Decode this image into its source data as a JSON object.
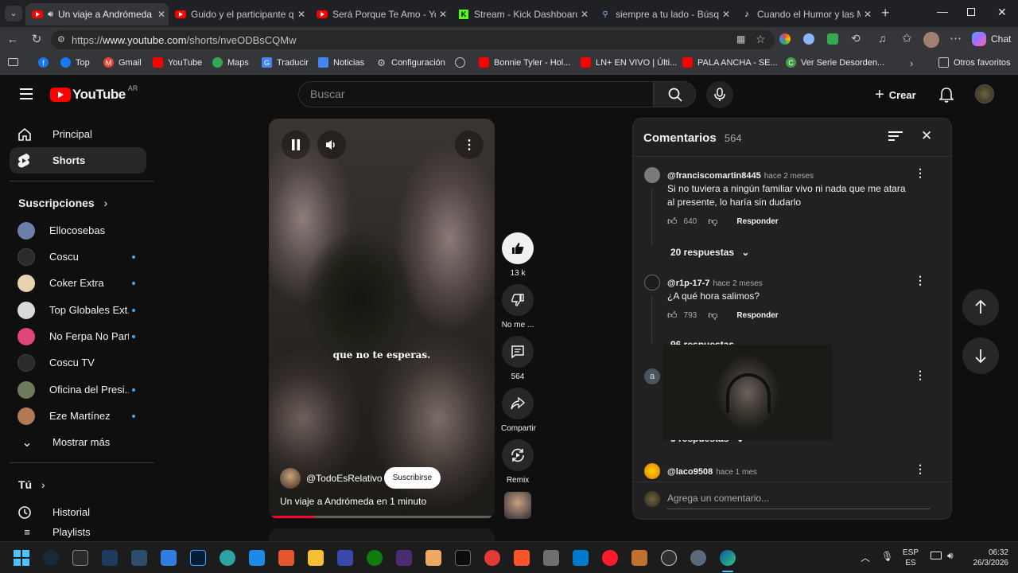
{
  "browser": {
    "tabs": [
      {
        "title": "Un viaje a Andrómeda en",
        "icon": "youtube",
        "active": true
      },
      {
        "title": "Guido y el participante que e",
        "icon": "youtube"
      },
      {
        "title": "Será Porque Te Amo - YouTub",
        "icon": "youtube"
      },
      {
        "title": "Stream - Kick Dashboard",
        "icon": "kick"
      },
      {
        "title": "siempre a tu lado - Búsqueda",
        "icon": "search"
      },
      {
        "title": "Cuando el Humor y las Mate",
        "icon": "tiktok"
      }
    ],
    "url_prefix": "https://",
    "url_host": "www.youtube.com",
    "url_path": "/shorts/nveODBsCQMw",
    "chat_label": "Chat",
    "bookmarks": [
      {
        "label": "Top",
        "color": "#1877f2"
      },
      {
        "label": "Gmail",
        "color": "#ea4335"
      },
      {
        "label": "YouTube",
        "color": "#ff0000"
      },
      {
        "label": "Maps",
        "color": "#34a853"
      },
      {
        "label": "Traducir",
        "color": "#4285f4"
      },
      {
        "label": "Noticias",
        "color": "#4285f4"
      },
      {
        "label": "Configuración",
        "color": "#9aa0a6"
      },
      {
        "label": "",
        "color": "#9aa0a6"
      },
      {
        "label": "Bonnie Tyler - Hol...",
        "color": "#ff0000"
      },
      {
        "label": "LN+ EN VIVO | Últi...",
        "color": "#ff0000"
      },
      {
        "label": "PALA ANCHA - SE...",
        "color": "#ff0000"
      },
      {
        "label": "Ver Serie Desorden...",
        "color": "#43a047"
      }
    ],
    "other_bookmarks": "Otros favoritos"
  },
  "youtube": {
    "logo_text": "YouTube",
    "country": "AR",
    "search_placeholder": "Buscar",
    "create_label": "Crear",
    "sidebar": {
      "main": [
        {
          "label": "Principal",
          "icon": "home-icon"
        },
        {
          "label": "Shorts",
          "icon": "shorts-icon"
        }
      ],
      "subs_header": "Suscripciones",
      "subs": [
        {
          "name": "Ellocosebas",
          "color": "#6b7fa8",
          "dot": false
        },
        {
          "name": "Coscu",
          "color": "#2a2a2a",
          "dot": true
        },
        {
          "name": "Coker Extra",
          "color": "#e8d2b0",
          "dot": true
        },
        {
          "name": "Top Globales Ext...",
          "color": "#d9d9d9",
          "dot": true
        },
        {
          "name": "No Ferpa No Party",
          "color": "#e0457a",
          "dot": true
        },
        {
          "name": "Coscu TV",
          "color": "#2a2a2a",
          "dot": false
        },
        {
          "name": "Oficina del Presi...",
          "color": "#6d7b5a",
          "dot": true
        },
        {
          "name": "Eze Martínez",
          "color": "#b07a55",
          "dot": true
        }
      ],
      "show_more": "Mostrar más",
      "you_header": "Tú",
      "history": "Historial",
      "playlists": "Playlists"
    },
    "short": {
      "caption": "que no te esperas.",
      "channel": "@TodoEsRelativo",
      "subscribe": "Suscribirse",
      "title": "Un viaje a Andrómeda en 1 minuto",
      "progress": 0.2
    },
    "actions": {
      "likes": "13 k",
      "dislike": "No me ...",
      "comments": "564",
      "share": "Compartir",
      "remix": "Remix"
    },
    "comments_panel": {
      "title": "Comentarios",
      "count": "564",
      "items": [
        {
          "author": "@franciscomartin8445",
          "time": "hace 2 meses",
          "text": "Si no tuviera a ningún familiar vivo ni nada que me atara al presente, lo haría sin dudarlo",
          "likes": "640",
          "reply": "Responder",
          "replies": "20 respuestas"
        },
        {
          "author": "@r1p-17-7",
          "time": "hace 2 meses",
          "text": "¿A qué hora salimos?",
          "likes": "793",
          "reply": "Responder",
          "replies": "96 respuestas"
        },
        {
          "author": "",
          "time": "",
          "text": "",
          "likes": "",
          "reply": "",
          "replies": "5 respuestas",
          "avatar_letter": "a"
        },
        {
          "author": "@laco9508",
          "time": "hace 1 mes",
          "text": "",
          "likes": "",
          "reply": ""
        }
      ],
      "add_placeholder": "Agrega un comentario..."
    }
  },
  "taskbar": {
    "lang_top": "ESP",
    "lang_bottom": "ES",
    "time": "06:32",
    "date": "26/3/2026"
  }
}
